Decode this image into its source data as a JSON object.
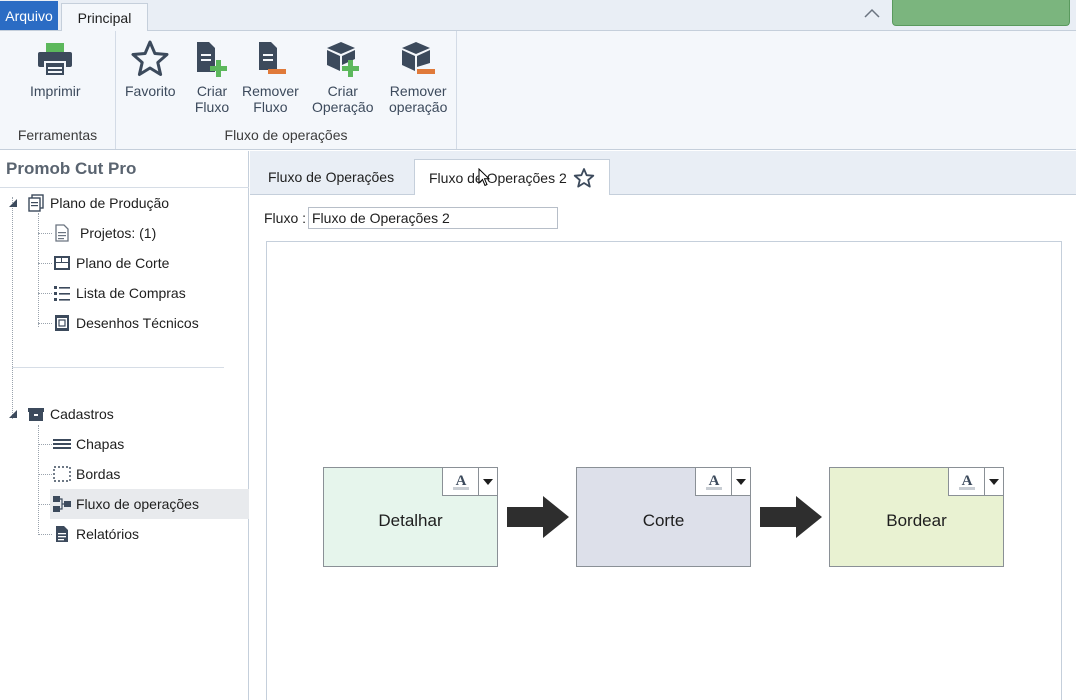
{
  "menubar": {
    "file_tab": "Arquivo",
    "main_tab": "Principal",
    "accent": "#2b6cc4"
  },
  "ribbon": {
    "groups": [
      {
        "label": "Ferramentas",
        "buttons": [
          {
            "label": "Imprimir",
            "icon": "printer-icon"
          }
        ]
      },
      {
        "label": "Fluxo de operações",
        "buttons": [
          {
            "label": "Favorito",
            "icon": "star-icon"
          },
          {
            "label_line1": "Criar",
            "label_line2": "Fluxo",
            "icon": "create-flow-icon"
          },
          {
            "label_line1": "Remover",
            "label_line2": "Fluxo",
            "icon": "remove-flow-icon"
          },
          {
            "label_line1": "Criar",
            "label_line2": "Operação",
            "icon": "create-operation-icon"
          },
          {
            "label_line1": "Remover",
            "label_line2": "operação",
            "icon": "remove-operation-icon"
          }
        ]
      }
    ]
  },
  "left_panel": {
    "title": "Promob Cut Pro",
    "tree": {
      "plano": {
        "label": "Plano de Produção",
        "children": [
          "Projetos: (1)",
          "Plano de Corte",
          "Lista de Compras",
          "Desenhos Técnicos"
        ]
      },
      "cadastros": {
        "label": "Cadastros",
        "children": [
          "Chapas",
          "Bordas",
          "Fluxo de operações",
          "Relatórios"
        ]
      }
    }
  },
  "doc_tabs": [
    "Fluxo de Operações",
    "Fluxo de Operações 2"
  ],
  "editor": {
    "fluxo_label": "Fluxo :",
    "fluxo_value": "Fluxo de Operações 2",
    "nodes": [
      {
        "label": "Detalhar",
        "color": "#e6f5ec"
      },
      {
        "label": "Corte",
        "color": "#dde0ea"
      },
      {
        "label": "Bordear",
        "color": "#e9f2d2"
      }
    ],
    "font_button_glyph": "A"
  }
}
